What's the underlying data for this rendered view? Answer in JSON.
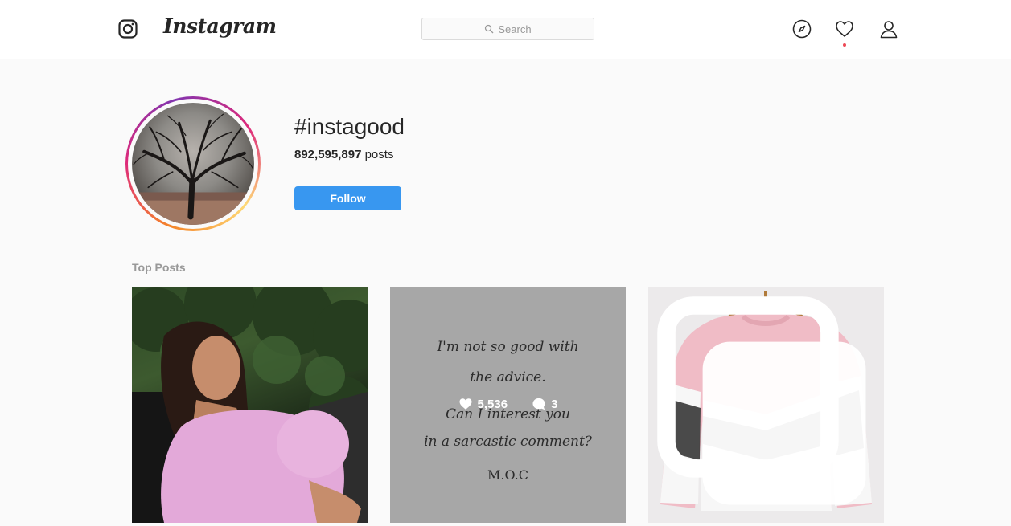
{
  "nav": {
    "brand": "Instagram",
    "search_placeholder": "Search",
    "icons": [
      "instagram-glyph-icon",
      "compass-icon",
      "heart-icon",
      "profile-icon"
    ]
  },
  "header": {
    "tag": "#instagood",
    "post_count": "892,595,897",
    "posts_label": "posts",
    "follow_label": "Follow"
  },
  "top_posts": {
    "label": "Top Posts",
    "posts": [
      {
        "kind": "photo"
      },
      {
        "kind": "quote",
        "quote_lines": [
          "I'm not so good with",
          "the advice.",
          "Can I interest you",
          "in a sarcastic comment?",
          "M.O.C"
        ],
        "likes": "5,536",
        "comments": "3"
      },
      {
        "kind": "photo",
        "multiple": true
      }
    ]
  },
  "colors": {
    "accent": "#3897f0",
    "notification": "#ed4956",
    "border": "#dbdbdb",
    "background": "#fafafa"
  }
}
